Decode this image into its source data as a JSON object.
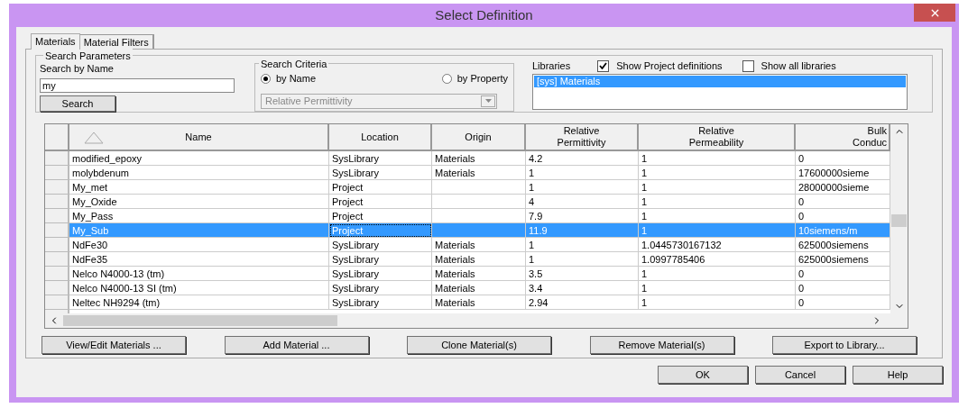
{
  "window": {
    "title": "Select Definition"
  },
  "tabs": [
    {
      "label": "Materials",
      "selected": true
    },
    {
      "label": "Material Filters",
      "selected": false
    }
  ],
  "search_parameters": {
    "title": "Search Parameters",
    "search_by_name_label": "Search by Name",
    "search_value": "my",
    "search_button": "Search"
  },
  "search_criteria": {
    "title": "Search Criteria",
    "options": [
      {
        "label": "by Name",
        "selected": true
      },
      {
        "label": "by Property",
        "selected": false
      }
    ],
    "property_value": "Relative Permittivity",
    "property_disabled": true
  },
  "libraries": {
    "label": "Libraries",
    "show_project_definitions": {
      "label": "Show Project definitions",
      "checked": true
    },
    "show_all_libraries": {
      "label": "Show all libraries",
      "checked": false
    },
    "items": [
      {
        "label": "[sys] Materials",
        "selected": true
      }
    ]
  },
  "table": {
    "columns": [
      "Name",
      "Location",
      "Origin",
      "Relative Permittivity",
      "Relative Permeability",
      "Bulk Conduc"
    ],
    "rows": [
      {
        "cells": [
          "modified_epoxy",
          "SysLibrary",
          "Materials",
          "4.2",
          "1",
          "0"
        ],
        "selected": false
      },
      {
        "cells": [
          "molybdenum",
          "SysLibrary",
          "Materials",
          "1",
          "1",
          "17600000sieme"
        ],
        "selected": false
      },
      {
        "cells": [
          "My_met",
          "Project",
          "",
          "1",
          "1",
          "28000000sieme"
        ],
        "selected": false
      },
      {
        "cells": [
          "My_Oxide",
          "Project",
          "",
          "4",
          "1",
          "0"
        ],
        "selected": false
      },
      {
        "cells": [
          "My_Pass",
          "Project",
          "",
          "7.9",
          "1",
          "0"
        ],
        "selected": false
      },
      {
        "cells": [
          "My_Sub",
          "Project",
          "",
          "11.9",
          "1",
          "10siemens/m"
        ],
        "selected": true
      },
      {
        "cells": [
          "NdFe30",
          "SysLibrary",
          "Materials",
          "1",
          "1.0445730167132",
          "625000siemens"
        ],
        "selected": false
      },
      {
        "cells": [
          "NdFe35",
          "SysLibrary",
          "Materials",
          "1",
          "1.0997785406",
          "625000siemens"
        ],
        "selected": false
      },
      {
        "cells": [
          "Nelco N4000-13 (tm)",
          "SysLibrary",
          "Materials",
          "3.5",
          "1",
          "0"
        ],
        "selected": false
      },
      {
        "cells": [
          "Nelco N4000-13 SI (tm)",
          "SysLibrary",
          "Materials",
          "3.4",
          "1",
          "0"
        ],
        "selected": false
      },
      {
        "cells": [
          "Neltec NH9294 (tm)",
          "SysLibrary",
          "Materials",
          "2.94",
          "1",
          "0"
        ],
        "selected": false
      }
    ]
  },
  "actions": [
    "View/Edit Materials ...",
    "Add Material ...",
    "Clone Material(s)",
    "Remove Material(s)",
    "Export to Library..."
  ],
  "dialog_buttons": [
    "OK",
    "Cancel",
    "Help"
  ]
}
